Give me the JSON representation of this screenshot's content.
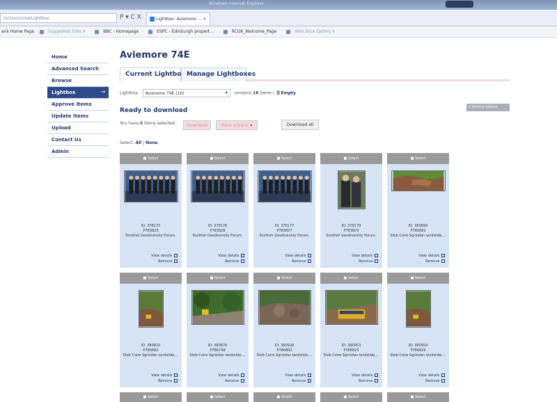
{
  "browser": {
    "window_title": "Windows Internet Explorer",
    "url": "/actions/viewLightbox",
    "nav_controls": "P ▾ C X",
    "tab_title": "Lightbox: Aviemore ... ×",
    "favorites": [
      "ank Home Page",
      "Suggested Sites ▾",
      "BBC - Homepage",
      "ESPC - Edinburgh propert...",
      "RCUK_Welcome_Page",
      "Web Slice Gallery ▾"
    ]
  },
  "sidebar": {
    "items": [
      {
        "label": "Home"
      },
      {
        "label": "Advanced Search"
      },
      {
        "label": "Browse"
      },
      {
        "label": "Lightbox",
        "active": true
      },
      {
        "label": "Approve Items"
      },
      {
        "label": "Update Items"
      },
      {
        "label": "Upload"
      },
      {
        "label": "Contact Us"
      },
      {
        "label": "Admin"
      }
    ],
    "active_arrow": "→"
  },
  "main": {
    "title": "Aviemore 74E",
    "tabs": [
      "Current Lightbox",
      "Manage Lightboxes"
    ],
    "lightbox_label": "Lightbox:",
    "lightbox_selected": "Aviemore 74E (16)",
    "contains_prefix": "contains",
    "contains_count": "16",
    "contains_suffix": "items |",
    "empty_label": "Empty",
    "ready_title": "Ready to download",
    "sorting_label": "▾ Sorting options",
    "selected_prefix": "You have",
    "selected_count": "0",
    "selected_suffix": "items selected.",
    "download_label": "Download",
    "more_actions_label": "More actions",
    "download_all_label": "Download all",
    "select_label": "Select:",
    "select_all": "All",
    "select_none": "None",
    "separator": "|"
  },
  "cards": [
    {
      "select": "Select",
      "id": "ID: 378175",
      "code": "P783825",
      "caption": "Scottish Geodiversity Forum.",
      "thumb": "group-photo"
    },
    {
      "select": "Select",
      "id": "ID: 378176",
      "code": "P783826",
      "caption": "Scottish Geodiversity Forum.",
      "thumb": "group-photo"
    },
    {
      "select": "Select",
      "id": "ID: 378177",
      "code": "P783827",
      "caption": "Scottish Geodiversity Forum.",
      "thumb": "group-photo"
    },
    {
      "select": "Select",
      "id": "ID: 378179",
      "code": "P783829",
      "caption": "Scottish Geodiversity Forum.",
      "thumb": "two-men"
    },
    {
      "select": "Select",
      "id": "ID: 380899",
      "code": "P786681",
      "caption": "Stob Coire Sgriodan landslide,...",
      "thumb": "landslide"
    },
    {
      "select": "Select",
      "id": "ID: 380810",
      "code": "P786682",
      "caption": "Stob Coire Sgriodan landslide,...",
      "thumb": "hillside"
    },
    {
      "select": "Select",
      "id": "ID: 380876",
      "code": "P786748",
      "caption": "Stob Coire Sgriodan landslide,...",
      "thumb": "trees-road"
    },
    {
      "select": "Select",
      "id": "ID: 380928",
      "code": "P786800",
      "caption": "Stob Coire Sgriodan landslide,...",
      "thumb": "rocks"
    },
    {
      "select": "Select",
      "id": "ID: 380953",
      "code": "P786825",
      "caption": "Stob Coire Sgriodan landslide,...",
      "thumb": "train"
    },
    {
      "select": "Select",
      "id": "ID: 380954",
      "code": "P786826",
      "caption": "Stob Coire Sgriodan landslide,...",
      "thumb": "hillside"
    }
  ],
  "card_links": {
    "view": "View details",
    "remove": "Remove"
  },
  "bottom_row_select": [
    "Select",
    "Select",
    "Select",
    "Select",
    "Select"
  ],
  "colors": {
    "accent": "#24396b",
    "sidebar_active": "#2c4a8a",
    "card_bg": "#d6e4f5",
    "select_bar": "#9a9a9a"
  }
}
